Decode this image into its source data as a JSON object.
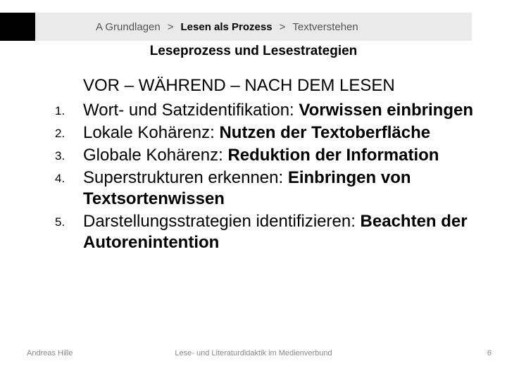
{
  "breadcrumb": {
    "item1": "A Grundlagen",
    "sep": ">",
    "item2": "Lesen als Prozess",
    "item3": "Textverstehen"
  },
  "subtitle": "Leseprozess und Lesestrategien",
  "headline": "VOR – WÄHREND – NACH DEM LESEN",
  "list": {
    "n1": "1.",
    "t1a": "Wort- und Satzidentifikation: ",
    "t1b": "Vorwissen einbringen",
    "n2": "2.",
    "t2a": "Lokale Kohärenz: ",
    "t2b": "Nutzen der Textoberfläche",
    "n3": "3.",
    "t3a": "Globale Kohärenz: ",
    "t3b": "Reduktion der Information",
    "n4": "4.",
    "t4a": "Superstrukturen erkennen: ",
    "t4b": "Einbringen von Textsortenwissen",
    "n5": "5.",
    "t5a": "Darstellungsstrategien identifizieren: ",
    "t5b": "Beachten der Autorenintention"
  },
  "footer": {
    "left": "Andreas Hille",
    "center": "Lese- und Literaturdidaktik im Medienverbund",
    "right": "6"
  }
}
